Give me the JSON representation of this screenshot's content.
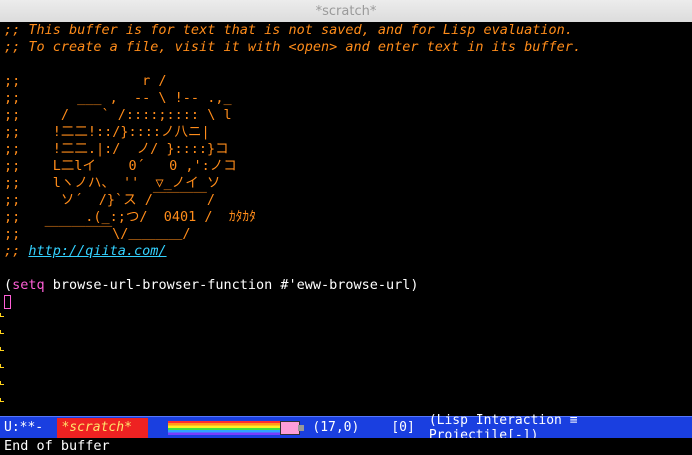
{
  "window": {
    "title": "*scratch*"
  },
  "buffer": {
    "comment_lines": [
      ";; This buffer is for text that is not saved, and for Lisp evaluation.",
      ";; To create a file, visit it with <open> and enter text in its buffer."
    ],
    "art_lines": [
      ";;               r /",
      ";;       ___ ,  -- \\ !-- .,_",
      ";;     /    ` /::::;:::: \\ l",
      ";;    !二二!::/}::::ノ八ニ|",
      ";;    !二二.|:/  ノ/ }::::}コ",
      ";;    L二lイ    0´   0 ,':ノコ",
      ";;    lヽノハ、 ''  ▽_ノイ ソ",
      ";;     ソ´  /}`ス /￣￣￣￣/",
      ";;        .(_:;つ/  0401 /  ｶﾀｶﾀ",
      ";;   ￣￣￣￣￣\\/＿＿＿＿/"
    ],
    "link_prefix": ";; ",
    "link_text": "http://qiita.com/",
    "code": {
      "open_paren": "(",
      "keyword": "setq",
      "rest": " browse-url-browser-function #'eww-browse-url",
      "close_paren": ")"
    }
  },
  "modeline": {
    "status": "U:**-",
    "buffer_name": "*scratch*",
    "position": "(17,0)",
    "count": "[0]",
    "mode": "(Lisp Interaction ≡ Projectile[-])"
  },
  "minibuffer": {
    "message": "End of buffer"
  },
  "colors": {
    "comment": "#ff8c1a",
    "link": "#33d1ff",
    "keyword": "#ff5fd7",
    "modeline_bg": "#1a3fe0",
    "buffer_name_bg": "#e22"
  }
}
